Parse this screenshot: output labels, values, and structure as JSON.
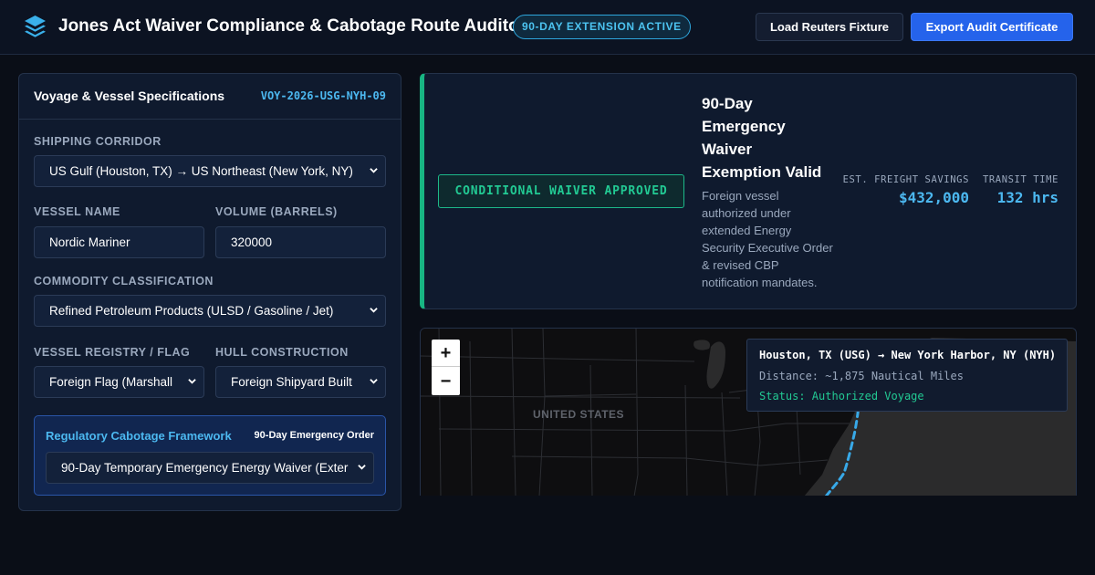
{
  "header": {
    "title": "Jones Act Waiver Compliance & Cabotage Route Auditor",
    "badge": "90-DAY EXTENSION ACTIVE",
    "load_button": "Load Reuters Fixture",
    "export_button": "Export Audit Certificate"
  },
  "voyage_panel": {
    "title": "Voyage & Vessel Specifications",
    "voyage_id": "VOY-2026-USG-NYH-09",
    "corridor": {
      "label": "SHIPPING CORRIDOR",
      "value": "US Gulf (Houston, TX) → US Northeast (New York, NY)"
    },
    "vessel_name": {
      "label": "VESSEL NAME",
      "value": "Nordic Mariner"
    },
    "volume": {
      "label": "VOLUME (BARRELS)",
      "value": "320000"
    },
    "commodity": {
      "label": "COMMODITY CLASSIFICATION",
      "value": "Refined Petroleum Products (ULSD / Gasoline / Jet)"
    },
    "registry": {
      "label": "VESSEL REGISTRY / FLAG",
      "value": "Foreign Flag (Marshall"
    },
    "hull": {
      "label": "HULL CONSTRUCTION",
      "value": "Foreign Shipyard Built"
    },
    "framework": {
      "title": "Regulatory Cabotage Framework",
      "tag": "90-Day Emergency Order",
      "value": "90-Day Temporary Emergency Energy Waiver (Exter"
    }
  },
  "status": {
    "badge": "CONDITIONAL WAIVER APPROVED",
    "title": "90-Day Emergency Waiver Exemption Valid",
    "description": "Foreign vessel authorized under extended Energy Security Executive Order & revised CBP notification mandates.",
    "savings_label": "EST. FREIGHT SAVINGS",
    "savings_value": "$432,000",
    "transit_label": "TRANSIT TIME",
    "transit_value": "132 hrs",
    "accent_color": "#18b583"
  },
  "map": {
    "country_label": "UNITED STATES",
    "zoom_in": "+",
    "zoom_out": "−",
    "popup": {
      "route": "Houston, TX (USG) → New York Harbor, NY (NYH)",
      "distance": "Distance: ~1,875 Nautical Miles",
      "status": "Status: Authorized Voyage"
    },
    "route_color": "#38a9e8"
  },
  "icons": {
    "logo": "layers-icon",
    "dropdown": "chevron-down-icon"
  }
}
